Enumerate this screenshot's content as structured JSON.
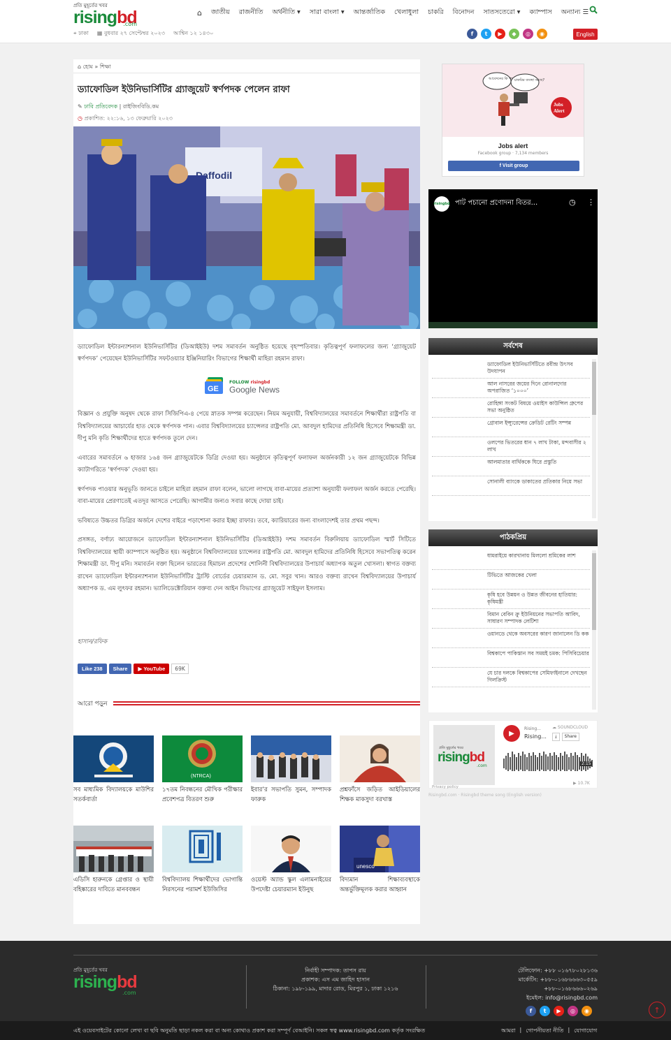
{
  "header": {
    "logo_tagline": "প্রতি মুহূর্তের খবর",
    "logo_brand_a": "rising",
    "logo_brand_b": "bd",
    "logo_domain": ".com",
    "nav": [
      "জাতীয়",
      "রাজনীতি",
      "অর্থনীতি ▾",
      "সারা বাংলা ▾",
      "আন্তর্জাতিক",
      "খেলাধুলা",
      "চাকরি",
      "বিনোদন",
      "সাতসতেরো ▾",
      "ক্যাম্পাস",
      "অন্যান্য ☰"
    ],
    "location": "ঢাকা",
    "date": "বুধবার ২৭ সেপ্টেম্বর ২০২৩",
    "bangla_date": "আশ্বিন ১২ ১৪৩০",
    "english_button": "English"
  },
  "article": {
    "breadcrumb_home": "হোম",
    "breadcrumb_sep": "»",
    "breadcrumb_section": "শিক্ষা",
    "headline": "ড্যাফোডিল ইউনিভার্সিটির গ্র্যাজুয়েট স্বর্ণপদক পেলেন রাফা",
    "author": "ঢাবি প্রতিবেদক",
    "source": "রাইজিংবিডি.কম",
    "published": "প্রকাশিত: ২২:১৬, ১৩ ফেব্রুয়ারি ২০২৩",
    "lead": "ড্যাফোডিল ইন্টারন্যাশনাল ইউনিভার্সিটির (ডিআইইউ) দশম সমাবর্তন অনুষ্ঠিত হয়েছে বৃহস্পতিবার। কৃতিত্বপূর্ণ ফলাফলের জন্য ‘গ্র্যাজুয়েট স্বর্ণপদক’ পেয়েছেন ইউনিভার্সিটির সফটওয়্যার ইঞ্জিনিয়ারিং বিভাগের শিক্ষার্থী মাহিরা রহমান রাফা।",
    "gnews_follow": "FOLLOW",
    "gnews_brand": "risingbd",
    "gnews_label": "Google News",
    "paragraphs": [
      "বিজ্ঞান ও প্রযুক্তি অনুষদ থেকে রাফা সিজিপিএ-৪ পেয়ে স্নাতক সম্পন্ন করেছেন। নিয়ম অনুযায়ী, বিশ্ববিদ্যালয়ের সমাবর্তনে শিক্ষার্থীরা রাষ্ট্রপতি বা বিশ্ববিদ্যালয়ের আচার্যের হাত থেকে স্বর্ণপদক পান। এবার বিশ্ববিদ্যালয়ের চ্যান্সেলর রাষ্ট্রপতি মো. আবদুল হামিদের প্রতিনিধি হিসেবে শিক্ষামন্ত্রী ডা. দীপু মনি কৃতি শিক্ষার্থীদের হাতে স্বর্ণপদক তুলে দেন।",
      "এবারের সমাবর্তনে ৬ হাজার ১৬৪ জন গ্র্যাজুয়েটকে ডিগ্রি দেওয়া হয়। অনুষ্ঠানে কৃতিত্বপূর্ণ ফলাফল অর্জনকারী ১২ জন গ্র্যাজুয়েটকে বিভিন্ন ক্যাটাগরিতে ‘স্বর্ণপদক’ দেওয়া হয়।",
      "স্বর্ণপদক পাওয়ার অনুভূতি জানতে চাইলে মাহিরা রহমান রাফা বলেন, ভালো লাগছে বাবা-মায়ের প্রত্যাশা অনুযায়ী ফলাফল অর্জন করতে পেরেছি। বাবা-মায়ের প্রেরণাতেই এতদূর আসতে পেরেছি। আগামীর জন্যও সবার কাছে দোয়া চাই।",
      "ভবিষ্যতে উচ্চতর ডিগ্রির অর্জনে দেশের বাইরে পড়াশোনা করার ইচ্ছা রাফার। তবে, ক্যারিয়ারের জন্য বাংলাদেশই তার প্রথম পছন্দ।",
      "প্রসঙ্গত, বর্ণাঢ্য আয়োজনে ড্যাফোডিল ইন্টারন্যাশনাল ইউনিভার্সিটির (ডিআইইউ) দশম সমাবর্তন বিরুলিয়ায় ড্যাফোডিল স্মার্ট সিটিতে বিশ্ববিদ্যালয়ের স্থায়ী ক্যাম্পাসে অনুষ্ঠিত হয়। অনুষ্ঠানে বিশ্ববিদ্যালয়ের চ্যান্সেলর রাষ্ট্রপতি মো. আবদুল হামিদের প্রতিনিধি হিসেবে সভাপতিত্ব করেন শিক্ষামন্ত্রী ডা. দীপু মনি। সমাবর্তন বক্তা ছিলেন ভারতের হিমাচল প্রদেশের শোলিনী বিশ্ববিদ্যালয়ের উপাচার্য অধ্যাপক অতুল খোসলা। স্বাগত বক্তব্য রাখেন ড্যাফোডিল ইন্টারন্যাশনাল ইউনিভার্সিটির ট্রাস্টি বোর্ডের চেয়ারম্যান ড. মো. সবুর খান। আরও বক্তব্য রাখেন বিশ্ববিদ্যালয়ের উপাচার্য অধ্যাপক ড. এম লুৎফর রহমান। ভ্যালিডেক্টোরিয়ান বক্তব্য দেন আইন বিভাগের গ্র্যাজুয়েট সাইফুল ইসলাম।"
    ],
    "reporter": "হাসান/রফিক",
    "like_label": "Like 238",
    "share_label": "Share",
    "youtube_label": "YouTube",
    "youtube_count": "69K",
    "more_label": "আরো পড়ুন"
  },
  "related": [
    {
      "title": "সব মাধ্যমিক বিদ্যালয়কে মাউশির সতর্কবার্তা"
    },
    {
      "title": "১৭তম নিবন্ধনের মৌখিক পরীক্ষার প্রবেশপত্র বিতরণ শুরু"
    },
    {
      "title": "ইবার’র সভাপতি সুমন, সম্পাদক ফারুক"
    },
    {
      "title": "প্রশ্নফাঁসে জড়িত আইডিয়ালের শিক্ষক মাকসুদা বরখাস্ত"
    },
    {
      "title": "এডিসি হারুনকে গ্রেপ্তার ও স্থায়ী বহিষ্কারের দাবিতে মানববন্ধন"
    },
    {
      "title": "বিশ্ববিদ্যালয় শিক্ষার্থীদের ভোগান্তি নিরসনের পরামর্শ ইউজিসির"
    },
    {
      "title": "ওয়েস্ট অ্যান্ড স্কুল এলামনাইয়ের উপদেষ্টা চেয়ারম্যান ইউনুছ"
    },
    {
      "title": "বিদ্যমান শিক্ষাব্যবস্থাকে অন্তর্ভুক্তিমূলক করার আহ্বান"
    }
  ],
  "related_thumb_labels": {
    "ntrca": "(NTRCA)",
    "unesco": "unesco"
  },
  "sidebar": {
    "jobs_bubble_1": "আবেদনের কি পদ্ধতি",
    "jobs_bubble_2": "চাকরির ব্যবস্থা আছে?",
    "jobs_badge": "Jobs Alert",
    "jobs_title": "Jobs alert",
    "jobs_sub": "Facebook group · 7,134 members",
    "jobs_visit": "Visit group",
    "video_logo": "risingbd",
    "video_title": "পাট পচানো প্রণোদনা বিতর...",
    "latest_head": "সর্বশেষ",
    "latest": [
      "ড্যাফোডিল ইউনিভার্সিটিতে রবীন্দ্র উৎসব উদযাপন",
      "আল নাসরের জয়ের দিনে রোনালদোর অপরাজিত ‘১০০০’",
      "রোহিঙ্গা সংকট বিষয়ে ওয়াইস কাউন্সিল গ্রুপের সভা অনুষ্ঠিত",
      "গ্রোবাল ইন্স্যুরেন্সের ক্রেডিট রেটিং সম্পন্ন",
      "ওলপের ভিতরের ধান ৭ লাখ টাকা, মন্দবাসীর ২ লাখ",
      "আলমাতার বার্থিককে ঘিরে প্রস্তুতি",
      "সোনালী ব্যাংকে ডাকাতের প্রতিকার নিয়ে সভা"
    ],
    "popular_head": "পাঠকপ্রিয়",
    "popular": [
      "ধামরাইয়ে কারখানায় মিললো শ্রমিকের লাশ",
      "টিভিতে আজকের খেলা",
      "কৃষি হবে উন্নয়ন ও উন্নত জীবনের হাতিয়ার: কৃষিমন্ত্রী",
      "বিমান বেবিন ক্রু ইউনিয়নের সভাপতি আবিদ, সাধারণ সম্পাদক লেটিশা",
      "ওয়ানডে থেকে অবসরের কারণ জানালেন ডি কক",
      "বিশ্বকাপে পাকিস্তান সব সময়ই চমক: পিসিবিচেয়ার",
      "যে চার দলকে বিশ্বকাপের সেমিফাইনালে দেখছেন গিলক্রিস্ট"
    ],
    "soundcloud": {
      "art_tagline": "প্রতি মুহূর্তের খবর",
      "user": "Rising...",
      "track": "Rising...",
      "logo": "SOUNDCLOUD",
      "share": "Share",
      "time": "2:15",
      "plays": "▶ 10.7K",
      "privacy": "Privacy policy",
      "footer": "Risingbd.com · Risingbd theme song (English version)"
    }
  },
  "footer": {
    "logo_tagline": "প্রতি মুহূর্তের খবর",
    "editor": "নির্বাহী সম্পাদক: তাপস রায়",
    "publisher": "প্রকাশক: এস এম জাহিদ হাসান",
    "address": "ঠিকানা: ১৯৮-১৯৯, মাদার রোড, মিরপুর ১, ঢাকা ১২১৬",
    "phone": "টেলিফোন: +৮৮ ০১৬৭৮০২৮১৩৬",
    "marketing_1": "মার্কেটিং: +৮৮-০১৬৮৬৬৬৩০৫৫৯",
    "marketing_2": "+৮৮-০১৬৮৬৬৬০২৬৯",
    "email": "ইমেইল: info@risingbd.com",
    "copyright": "এই ওয়েবসাইটের কোনো লেখা বা ছবি অনুমতি ছাড়া নকল করা বা অন্য কোথাও প্রকাশ করা সম্পূর্ণ বেআইনি। সকল স্বত্ব www.risingbd.com কর্তৃক সংরক্ষিত",
    "links": [
      "আমরা",
      "গোপনীয়তা নীতি",
      "যোগাযোগ"
    ]
  },
  "colors": {
    "brand_green": "#1a8a3a",
    "brand_red": "#d32027",
    "facebook": "#3b5998",
    "twitter": "#1da1f2",
    "youtube": "#e62117",
    "android": "#78c257",
    "instagram": "#c13584",
    "rss": "#f29111"
  }
}
